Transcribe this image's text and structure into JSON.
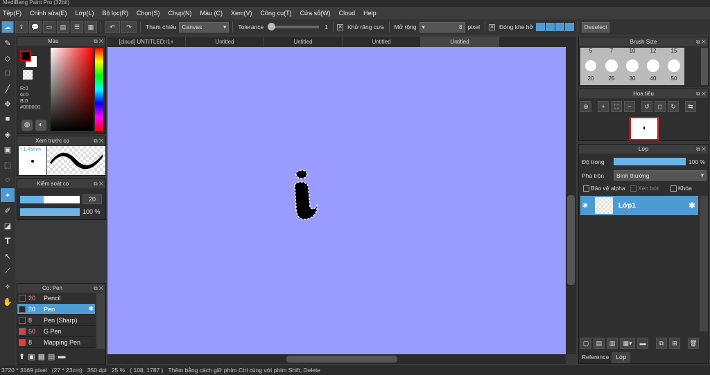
{
  "window": {
    "title": "MediBang Paint Pro (32bit)"
  },
  "menu": [
    "Tệp(F)",
    "Chỉnh sửa(E)",
    "Lớp(L)",
    "Bộ lọc(R)",
    "Chọn(S)",
    "Chụp(N)",
    "Màu (C)",
    "Xem(V)",
    "Công cụ(T)",
    "Cửa sổ(W)",
    "Cloud",
    "Help"
  ],
  "toolbar": {
    "reference_label": "Tham chiếu",
    "reference_value": "Canvas",
    "tolerance_label": "Tolerance",
    "tolerance_value": "1",
    "antialias_label": "Khử răng cưa",
    "expand_label": "Mở rộng",
    "expand_value": "8",
    "expand_unit": "pixel",
    "close_gap_label": "Đóng khe hở",
    "deselect_label": "Deselect"
  },
  "color_panel": {
    "title": "Màu",
    "r": "R:0",
    "g": "G:0",
    "b": "B:0",
    "hex": "#000000"
  },
  "brush_preview": {
    "title": "Xem trước cọ",
    "size": "* 1.45mm"
  },
  "brush_control": {
    "title": "Kiểm soát cọ",
    "size_value": "20",
    "opacity_value": "100 %",
    "size_fraction": 0.4,
    "opacity_fraction": 1.0
  },
  "brush_list": {
    "title": "Cọ: Pen",
    "items": [
      {
        "size": "20",
        "name": "Pencil",
        "color": "#2a2a2a"
      },
      {
        "size": "20",
        "name": "Pen",
        "color": "#2a2a2a"
      },
      {
        "size": "8",
        "name": "Pen (Sharp)",
        "color": "#2a2a2a"
      },
      {
        "size": "50",
        "name": "G Pen",
        "color": "#e04040"
      },
      {
        "size": "8",
        "name": "Mapping Pen",
        "color": "#e04040"
      }
    ]
  },
  "tabs": [
    "[cloud] UNTITLED:r1+",
    "Untitled",
    "Untitled",
    "Untitled",
    "Untitled"
  ],
  "brush_size_panel": {
    "title": "Brush Size",
    "top_labels": [
      "5",
      "7",
      "10",
      "12",
      "15"
    ],
    "bottom_labels": [
      "20",
      "25",
      "30",
      "40",
      "50"
    ]
  },
  "navigator": {
    "title": "Hoa tiêu"
  },
  "layer_panel": {
    "title": "Lớp",
    "opacity_label": "Độ trong",
    "opacity_value": "100 %",
    "blend_label": "Pha trộn",
    "blend_value": "Bình thường",
    "protect_alpha": "Bảo vệ alpha",
    "clipping": "Xén bớt",
    "lock": "Khóa",
    "layer_name": "Lớp1",
    "bottom_tabs": [
      "Reference",
      "Lớp"
    ]
  },
  "status": {
    "dimensions": "3720 * 3169 pixel",
    "physical": "(27 * 23cm)",
    "dpi": "350 dpi",
    "zoom": "25 %",
    "coords": "( 108, 1787 )",
    "hint": "Thêm bằng cách giữ phím Ctrl cùng với phím Shift, Delete"
  },
  "colors": {
    "canvas": "#9a9bff",
    "accent": "#4e9bd3"
  }
}
